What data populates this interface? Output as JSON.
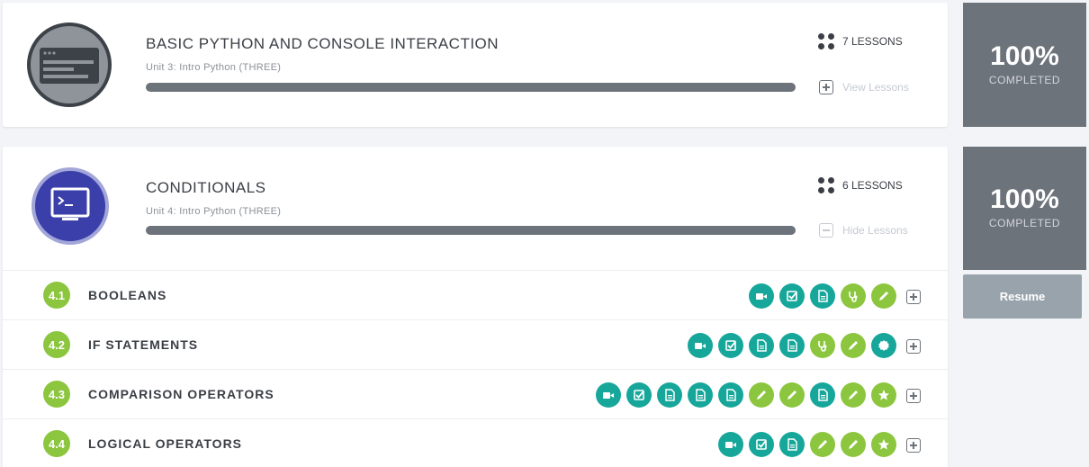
{
  "units": [
    {
      "title": "BASIC PYTHON AND CONSOLE INTERACTION",
      "subtitle": "Unit 3: Intro Python (THREE)",
      "lessons_count": "7 LESSONS",
      "toggle_label": "View Lessons",
      "progress": 1.0,
      "percent": "100%",
      "percent_label": "COMPLETED"
    },
    {
      "title": "CONDITIONALS",
      "subtitle": "Unit 4: Intro Python (THREE)",
      "lessons_count": "6 LESSONS",
      "toggle_label": "Hide Lessons",
      "progress": 1.0,
      "percent": "100%",
      "percent_label": "COMPLETED",
      "resume_label": "Resume",
      "lessons": [
        {
          "number": "4.1",
          "title": "BOOLEANS",
          "activities": [
            "video:teal",
            "check:teal",
            "doc:teal",
            "stethoscope:green",
            "pencil:green"
          ]
        },
        {
          "number": "4.2",
          "title": "IF STATEMENTS",
          "activities": [
            "video:teal",
            "check:teal",
            "doc:teal",
            "doc:teal",
            "stethoscope:green",
            "pencil:green",
            "badge:teal"
          ]
        },
        {
          "number": "4.3",
          "title": "COMPARISON OPERATORS",
          "activities": [
            "video:teal",
            "check:teal",
            "doc:teal",
            "doc:teal",
            "doc:teal",
            "pencil:green",
            "pencil:green",
            "doc:teal",
            "pencil:green",
            "star:green"
          ]
        },
        {
          "number": "4.4",
          "title": "LOGICAL OPERATORS",
          "activities": [
            "video:teal",
            "check:teal",
            "doc:teal",
            "pencil:green",
            "pencil:green",
            "star:green"
          ]
        }
      ]
    }
  ],
  "colors": {
    "teal": "#17a79a",
    "green": "#8cc63f",
    "gray": "#6d737a"
  }
}
